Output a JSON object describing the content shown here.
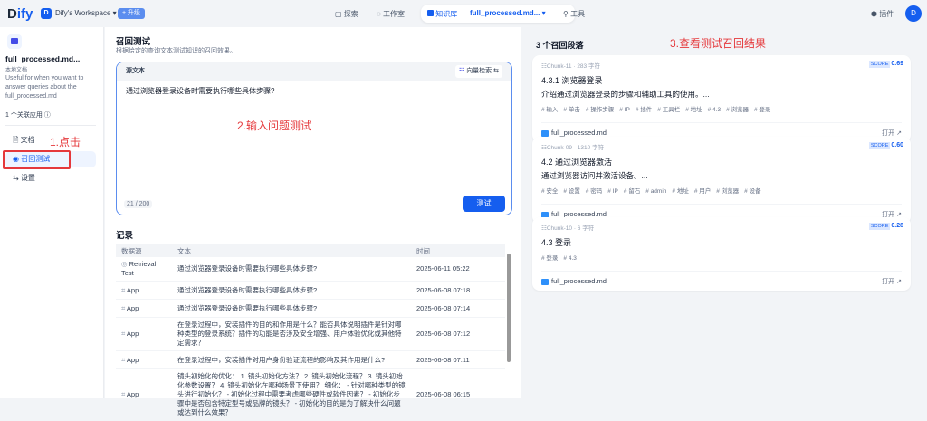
{
  "header": {
    "logo": "Dify",
    "workspace_initial": "D",
    "workspace": "Dify's Workspace",
    "upgrade": "+ 升级",
    "nav": [
      "探索",
      "工作室",
      "知识库",
      "full_processed.md...",
      "工具"
    ],
    "plugins": "插件",
    "avatar": "D"
  },
  "sidebar": {
    "dataset_name": "full_processed.md...",
    "dataset_type": "本地文档",
    "description": "Useful for when you want to answer queries about the full_processed.md",
    "linked_apps": "1 个关联应用",
    "items": [
      {
        "label": "文档"
      },
      {
        "label": "召回测试"
      },
      {
        "label": "设置"
      }
    ]
  },
  "annotations": {
    "step1": "1.点击",
    "step2": "2.输入问题测试",
    "step3": "3.查看测试召回结果"
  },
  "main": {
    "title": "召回测试",
    "subtitle": "根据给定的查询文本测试知识的召回效果。",
    "source_label": "源文本",
    "retrieval_mode": "向量检索",
    "query": "通过浏览器登录设备时需要执行哪些具体步骤?",
    "char_count": "21",
    "char_max": "200",
    "test_button": "测试",
    "records_title": "记录",
    "columns": [
      "数据源",
      "文本",
      "时间"
    ],
    "records": [
      {
        "source": "Retrieval Test",
        "text": "通过浏览器登录设备时需要执行哪些具体步骤?",
        "time": "2025-06-11 05:22"
      },
      {
        "source": "App",
        "text": "通过浏览器登录设备时需要执行哪些具体步骤?",
        "time": "2025-06-08 07:18"
      },
      {
        "source": "App",
        "text": "通过浏览器登录设备时需要执行哪些具体步骤?",
        "time": "2025-06-08 07:14"
      },
      {
        "source": "App",
        "text": "在登录过程中，安装插件的目的和作用是什么？能否具体说明插件是针对哪种类型的登录系统？插件的功能是否涉及安全增强、用户体验优化或其他特定需求？",
        "time": "2025-06-08 07:12"
      },
      {
        "source": "App",
        "text": "在登录过程中，安装插件对用户身份验证流程的影响及其作用是什么?",
        "time": "2025-06-08 07:11"
      },
      {
        "source": "App",
        "text": "镜头初始化的优化： 1. 镜头初始化方法？ 2. 镜头初始化流程？ 3. 镜头初始化参数设置？ 4. 镜头初始化在哪种场景下使用？ 细化： - 针对哪种类型的镜头进行初始化？ - 初始化过程中需要考虑哪些硬件或软件因素？ - 初始化步骤中是否包含特定型号或品牌的镜头？ - 初始化的目的是为了解决什么问题或达到什么效果？",
        "time": "2025-06-08 06:15"
      }
    ]
  },
  "results": {
    "title": "3 个召回段落",
    "score_label": "SCORE",
    "open_label": "打开",
    "cards": [
      {
        "chunk": "Chunk-11",
        "chars": "283 字符",
        "score": "0.69",
        "title": "4.3.1 浏览器登录",
        "desc": "介绍通过浏览器登录的步骤和辅助工具的使用。...",
        "tags": [
          "输入",
          "单击",
          "操作步骤",
          "IP",
          "插件",
          "工具栏",
          "地址",
          "4.3",
          "浏览器",
          "登录"
        ],
        "file": "full_processed.md"
      },
      {
        "chunk": "Chunk-09",
        "chars": "1310 字符",
        "score": "0.60",
        "title": "4.2 通过浏览器激活",
        "desc": "通过浏览器访问并激活设备。...",
        "tags": [
          "安全",
          "设置",
          "密码",
          "IP",
          "留石",
          "admin",
          "地址",
          "用户",
          "浏览器",
          "设备"
        ],
        "file": "full_processed.md"
      },
      {
        "chunk": "Chunk-10",
        "chars": "6 字符",
        "score": "0.28",
        "title": "4.3 登录",
        "desc": "",
        "tags": [
          "登录",
          "4.3"
        ],
        "file": "full_processed.md"
      }
    ]
  }
}
